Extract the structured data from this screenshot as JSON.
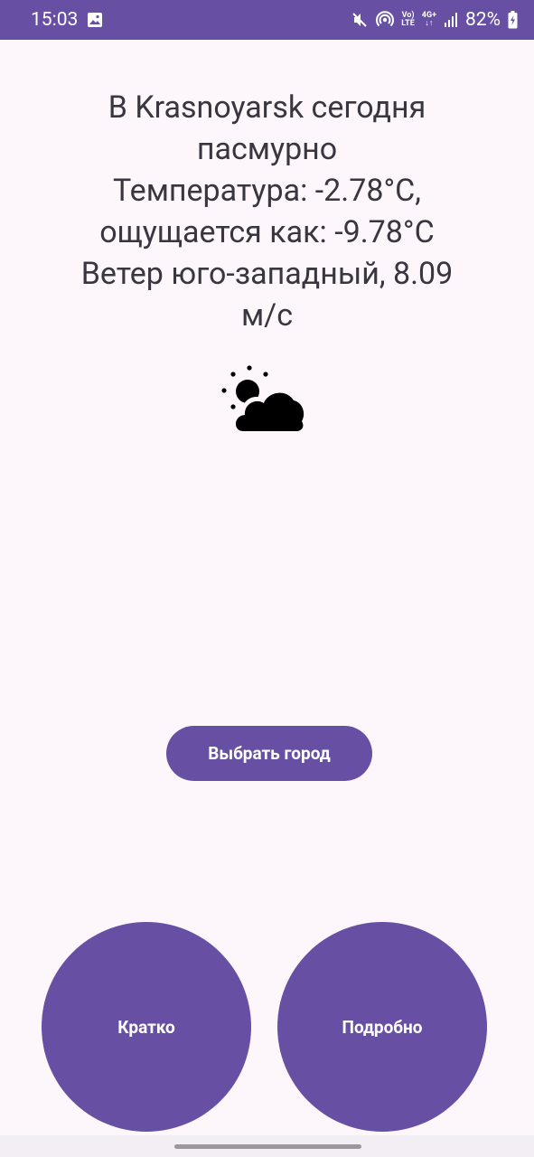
{
  "status_bar": {
    "time": "15:03",
    "battery_percent": "82%",
    "lte_top": "Vo)",
    "lte_bottom": "LTE",
    "net_top": "4G+",
    "net_bottom": "↓↑",
    "icons": [
      "image-icon",
      "mute-icon",
      "hotspot-icon",
      "volte-icon",
      "4g-icon",
      "signal-icon",
      "battery-charging-icon"
    ]
  },
  "weather": {
    "description": "В Krasnoyarsk сегодня\nпасмурно\nТемпература: -2.78°C,\nощущается как: -9.78°C\nВетер юго-западный, 8.09\nм/с",
    "icon": "partly-cloudy-icon"
  },
  "buttons": {
    "choose_city": "Выбрать город",
    "short": "Кратко",
    "detailed": "Подробно"
  },
  "colors": {
    "primary": "#6750A4",
    "background": "#FDF7FC",
    "text": "#3A363F"
  }
}
